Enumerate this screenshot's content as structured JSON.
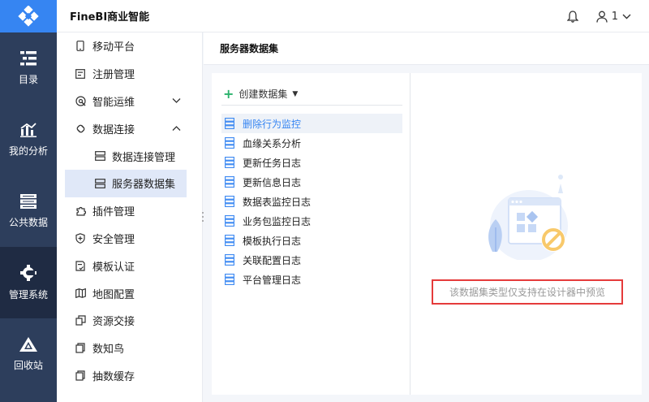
{
  "rail": {
    "items": [
      {
        "label": "目录",
        "icon": "catalog-icon"
      },
      {
        "label": "我的分析",
        "icon": "analysis-chart-icon"
      },
      {
        "label": "公共数据",
        "icon": "public-data-icon"
      },
      {
        "label": "管理系统",
        "icon": "management-gear-icon",
        "active": true
      },
      {
        "label": "回收站",
        "icon": "recycle-bin-icon"
      }
    ]
  },
  "topbar": {
    "title": "FineBI商业智能",
    "user": "1"
  },
  "menu": {
    "items": [
      {
        "label": "移动平台",
        "icon": "mobile-icon"
      },
      {
        "label": "注册管理",
        "icon": "register-icon"
      },
      {
        "label": "智能运维",
        "icon": "ops-icon",
        "chevron": "down"
      },
      {
        "label": "数据连接",
        "icon": "link-icon",
        "chevron": "up"
      },
      {
        "label": "数据连接管理",
        "icon": "connection-manage-icon",
        "sub": true
      },
      {
        "label": "服务器数据集",
        "icon": "server-dataset-icon",
        "sub": true,
        "selected": true
      },
      {
        "label": "插件管理",
        "icon": "plugin-icon"
      },
      {
        "label": "安全管理",
        "icon": "shield-icon"
      },
      {
        "label": "模板认证",
        "icon": "template-cert-icon"
      },
      {
        "label": "地图配置",
        "icon": "map-icon"
      },
      {
        "label": "资源交接",
        "icon": "resource-handover-icon"
      },
      {
        "label": "数知鸟",
        "icon": "shuzhiniao-icon"
      },
      {
        "label": "抽数缓存",
        "icon": "extract-cache-icon"
      }
    ]
  },
  "content": {
    "breadcrumb": "服务器数据集",
    "create_label": "创建数据集",
    "datasets": [
      "删除行为监控",
      "血缘关系分析",
      "更新任务日志",
      "更新信息日志",
      "数据表监控日志",
      "业务包监控日志",
      "模板执行日志",
      "关联配置日志",
      "平台管理日志"
    ],
    "notice": "该数据集类型仅支持在设计器中预览"
  },
  "colors": {
    "rail_bg": "#2d3e5c",
    "rail_active": "#1f2b43",
    "accent": "#3685f2",
    "plus_green": "#2ab26c",
    "notice_border": "#e53b3b"
  }
}
